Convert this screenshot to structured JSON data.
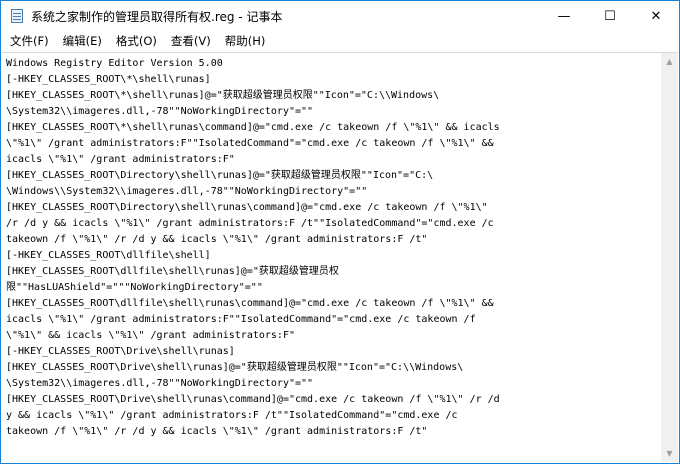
{
  "window": {
    "title": "系统之家制作的管理员取得所有权.reg - 记事本",
    "minimize": "—",
    "maximize": "☐",
    "close": "✕"
  },
  "menu": [
    "文件(F)",
    "编辑(E)",
    "格式(O)",
    "查看(V)",
    "帮助(H)"
  ],
  "lines": [
    "Windows Registry Editor Version 5.00",
    "[-HKEY_CLASSES_ROOT\\*\\shell\\runas]",
    "[HKEY_CLASSES_ROOT\\*\\shell\\runas]@=\"获取超级管理员权限\"\"Icon\"=\"C:\\\\Windows\\",
    "\\System32\\\\imageres.dll,-78\"\"NoWorkingDirectory\"=\"\"",
    "[HKEY_CLASSES_ROOT\\*\\shell\\runas\\command]@=\"cmd.exe /c takeown /f \\\"%1\\\" && icacls",
    "\\\"%1\\\" /grant administrators:F\"\"IsolatedCommand\"=\"cmd.exe /c takeown /f \\\"%1\\\" &&",
    "icacls \\\"%1\\\" /grant administrators:F\"",
    "[HKEY_CLASSES_ROOT\\Directory\\shell\\runas]@=\"获取超级管理员权限\"\"Icon\"=\"C:\\",
    "\\Windows\\\\System32\\\\imageres.dll,-78\"\"NoWorkingDirectory\"=\"\"",
    "[HKEY_CLASSES_ROOT\\Directory\\shell\\runas\\command]@=\"cmd.exe /c takeown /f \\\"%1\\\"",
    "/r /d y && icacls \\\"%1\\\" /grant administrators:F /t\"\"IsolatedCommand\"=\"cmd.exe /c",
    "takeown /f \\\"%1\\\" /r /d y && icacls \\\"%1\\\" /grant administrators:F /t\"",
    "[-HKEY_CLASSES_ROOT\\dllfile\\shell]",
    "[HKEY_CLASSES_ROOT\\dllfile\\shell\\runas]@=\"获取超级管理员权",
    "限\"\"HasLUAShield\"=\"\"\"NoWorkingDirectory\"=\"\"",
    "[HKEY_CLASSES_ROOT\\dllfile\\shell\\runas\\command]@=\"cmd.exe /c takeown /f \\\"%1\\\" &&",
    "icacls \\\"%1\\\" /grant administrators:F\"\"IsolatedCommand\"=\"cmd.exe /c takeown /f",
    "\\\"%1\\\" && icacls \\\"%1\\\" /grant administrators:F\"",
    "[-HKEY_CLASSES_ROOT\\Drive\\shell\\runas]",
    "[HKEY_CLASSES_ROOT\\Drive\\shell\\runas]@=\"获取超级管理员权限\"\"Icon\"=\"C:\\\\Windows\\",
    "\\System32\\\\imageres.dll,-78\"\"NoWorkingDirectory\"=\"\"",
    "[HKEY_CLASSES_ROOT\\Drive\\shell\\runas\\command]@=\"cmd.exe /c takeown /f \\\"%1\\\" /r /d",
    "y && icacls \\\"%1\\\" /grant administrators:F /t\"\"IsolatedCommand\"=\"cmd.exe /c",
    "takeown /f \\\"%1\\\" /r /d y && icacls \\\"%1\\\" /grant administrators:F /t\""
  ],
  "scrollbar": {
    "up": "▲",
    "down": "▼"
  }
}
